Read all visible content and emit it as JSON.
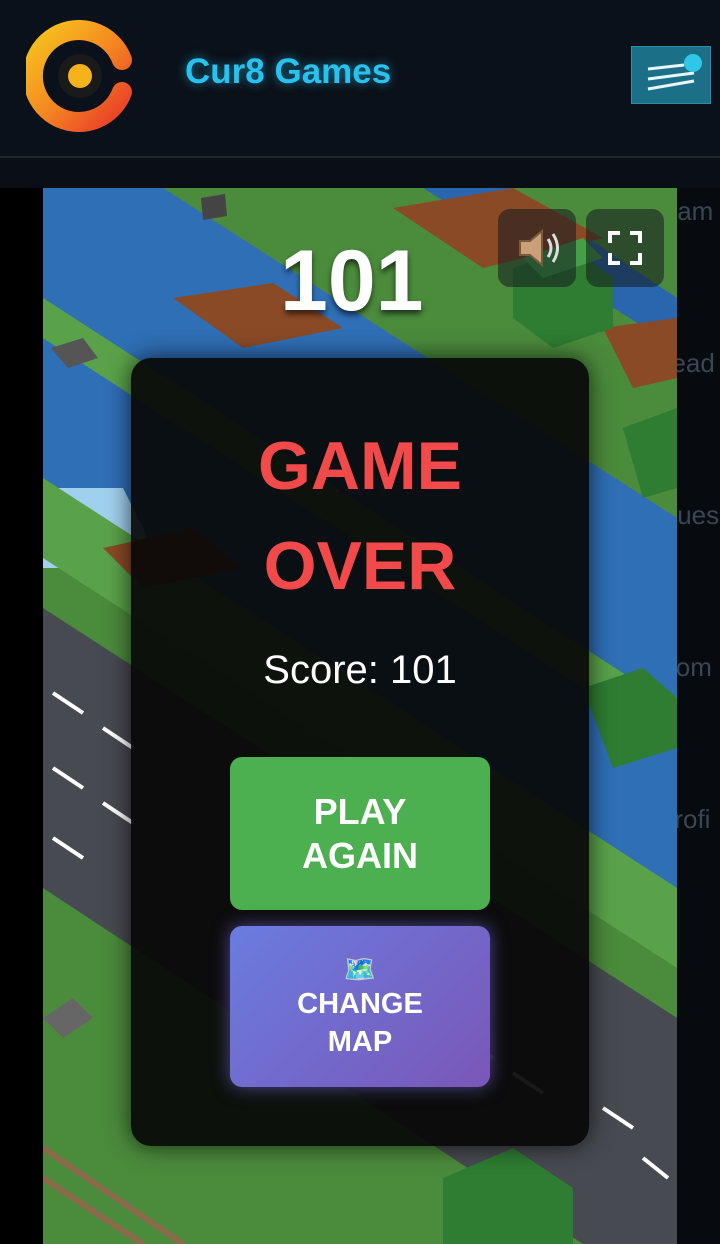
{
  "header": {
    "brand": "Cur8 Games",
    "logo_icon": "cur8-logo-icon",
    "menu_icon": "hamburger-menu-icon"
  },
  "side_nav": [
    "Gam",
    "Lead",
    "Ques",
    "Com",
    "Profi"
  ],
  "game": {
    "score": "101",
    "sound_icon": "speaker-icon",
    "fullscreen_icon": "fullscreen-icon"
  },
  "dialog": {
    "title_line1": "GAME",
    "title_line2": "OVER",
    "score_label": "Score: 101",
    "play_again_line1": "PLAY",
    "play_again_line2": "AGAIN",
    "change_map_icon": "🗺️",
    "change_map_line1": "CHANGE",
    "change_map_line2": "MAP"
  },
  "colors": {
    "brand": "#27c3f0",
    "game_over": "#f24a4a",
    "play_button": "#4caf50",
    "map_button_start": "#6a7cdf",
    "map_button_end": "#7a57b8"
  }
}
